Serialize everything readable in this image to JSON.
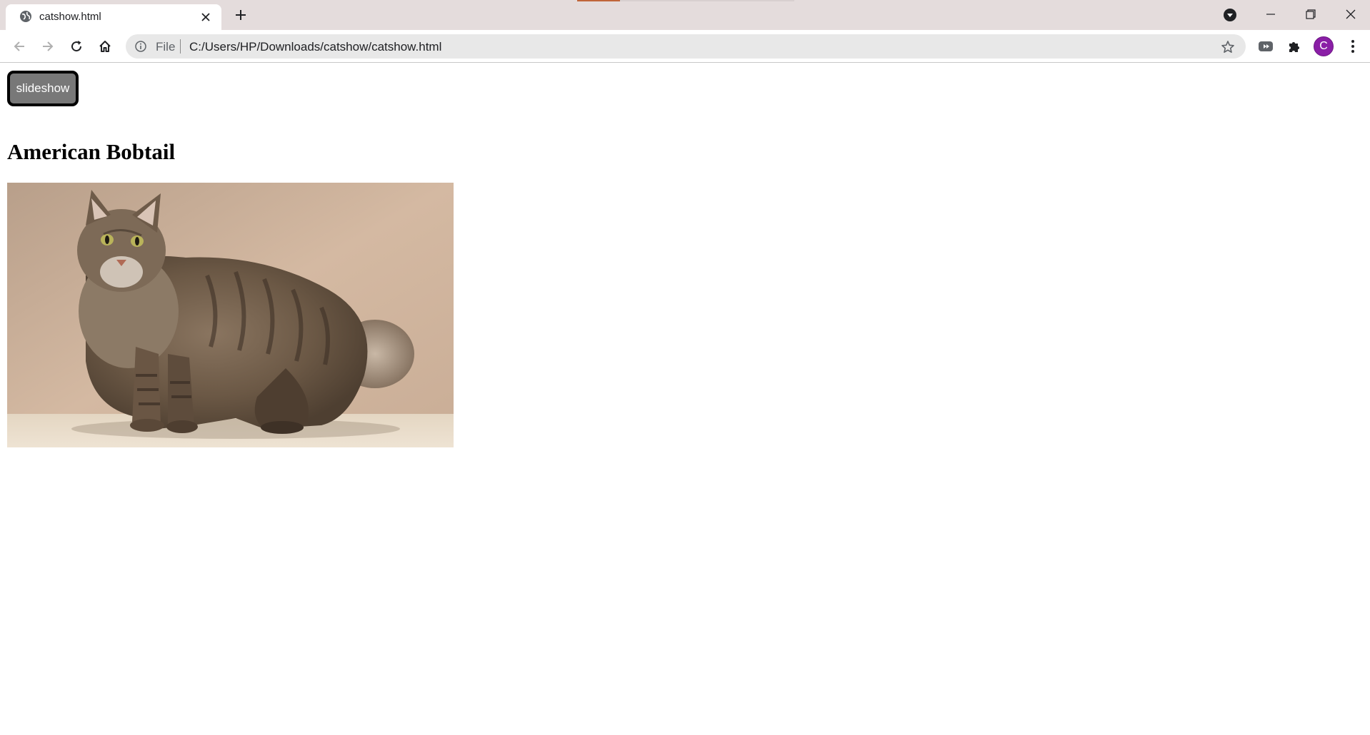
{
  "browser": {
    "tab": {
      "title": "catshow.html",
      "favicon": "globe-icon"
    },
    "icons": {
      "close_tab": "close-icon",
      "new_tab": "plus-icon",
      "tab_search": "tab-search-icon",
      "minimize": "minimize-icon",
      "restore": "restore-icon",
      "close_window": "close-icon"
    },
    "toolbar": {
      "back": "back-arrow-icon",
      "forward": "forward-arrow-icon",
      "reload": "reload-icon",
      "home": "home-icon",
      "address": {
        "scheme_label": "File",
        "url": "C:/Users/HP/Downloads/catshow/catshow.html"
      },
      "bookmark": "star-icon",
      "media": "media-router-icon",
      "extensions": "puzzle-icon",
      "profile_initial": "C",
      "menu": "more-vert-icon"
    },
    "colors": {
      "tabstrip": "#e4dcdc",
      "avatar": "#8a1ea6"
    }
  },
  "page": {
    "slideshow_label": "slideshow",
    "heading": "American Bobtail",
    "image": "american-bobtail-cat-photo"
  }
}
